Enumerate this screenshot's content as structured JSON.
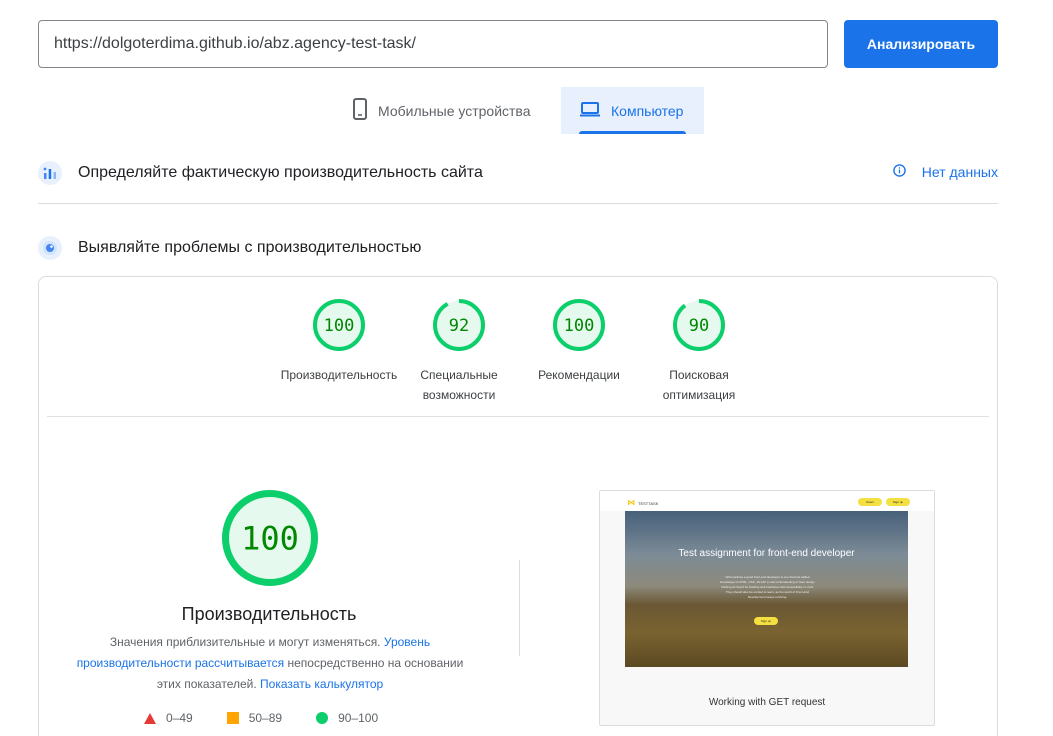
{
  "search": {
    "url_value": "https://dolgoterdima.github.io/abz.agency-test-task/",
    "analyze_label": "Анализировать"
  },
  "tabs": [
    {
      "label": "Мобильные устройства",
      "icon": "smartphone-icon",
      "active": false
    },
    {
      "label": "Компьютер",
      "icon": "laptop-icon",
      "active": true
    }
  ],
  "field_data": {
    "title": "Определяйте фактическую производительность сайта",
    "status": "Нет данных",
    "icon": "crux-icon"
  },
  "lab_data": {
    "title": "Выявляйте проблемы с производительностью",
    "icon": "lighthouse-icon"
  },
  "categories": [
    {
      "score": "100",
      "value": 100,
      "label": "Производительность"
    },
    {
      "score": "92",
      "value": 92,
      "label": "Специальные возможности"
    },
    {
      "score": "100",
      "value": 100,
      "label": "Рекомендации"
    },
    {
      "score": "90",
      "value": 90,
      "label": "Поисковая оптимизация"
    }
  ],
  "performance": {
    "score": "100",
    "value": 100,
    "title": "Производительность",
    "desc_text1": "Значения приблизительные и могут изменяться.",
    "desc_link1": "Уровень производительности рассчитывается",
    "desc_text2": "непосредственно на основании этих показателей.",
    "desc_link2": "Показать калькулятор"
  },
  "legend": [
    {
      "range": "0–49",
      "color": "#e53935",
      "shape": "triangle"
    },
    {
      "range": "50–89",
      "color": "#ffa400",
      "shape": "square"
    },
    {
      "range": "90–100",
      "color": "#0cce6b",
      "shape": "circle"
    }
  ],
  "screenshot": {
    "logo_text": "TESTTASK",
    "nav_users": "Users",
    "nav_signup": "Sign up",
    "hero_title": "Test assignment for front-end developer",
    "hero_text": "What defines a good front-end developer is one that has skilled knowledge of HTML, CSS, JS with a vast understanding of User design thinking as they'll be building web interfaces with accessibility in mind. They should also be excited to learn, as the world of Front-End Development keeps evolving.",
    "signup_label": "Sign up",
    "caption": "Working with GET request"
  },
  "colors": {
    "accent": "#1a73e8",
    "pass": "#0cce6b",
    "pass_text": "#008800",
    "pass_bg": "#e6f9ee"
  }
}
